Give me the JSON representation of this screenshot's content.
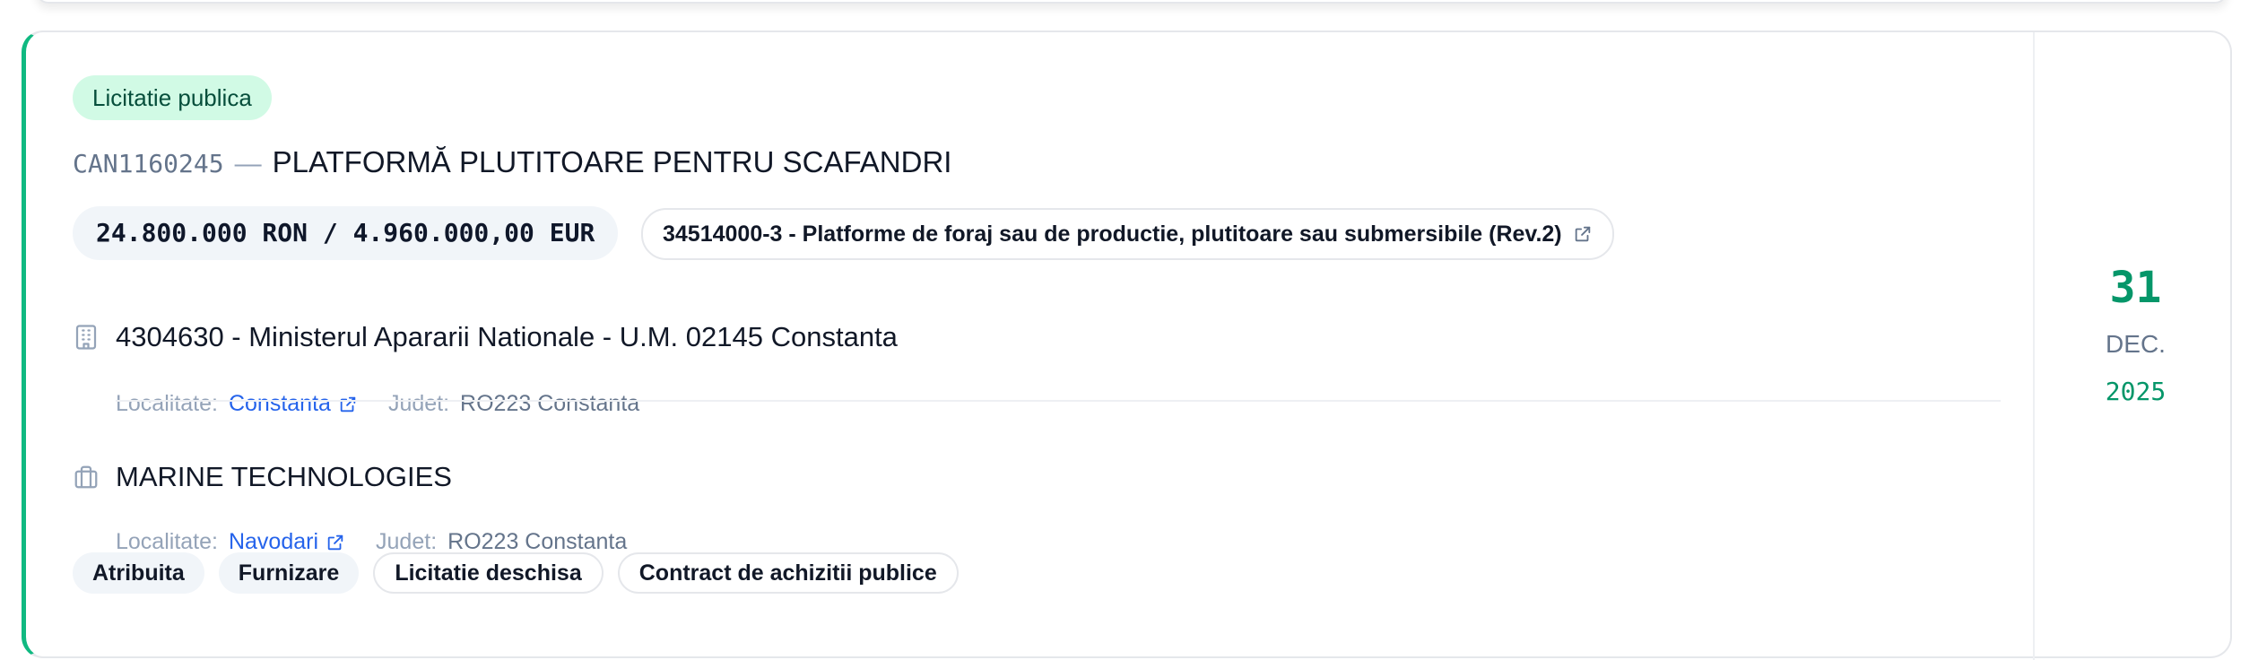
{
  "notice": {
    "type_badge": "Licitatie publica",
    "code": "CAN1160245",
    "separator": "—",
    "title": "PLATFORMĂ PLUTITOARE PENTRU SCAFANDRI",
    "value": "24.800.000 RON / 4.960.000,00 EUR",
    "cpv": "34514000-3 - Platforme de foraj sau de productie, plutitoare sau submersibile (Rev.2)"
  },
  "authority": {
    "name": "4304630 - Ministerul Apararii Nationale - U.M. 02145 Constanta",
    "locality_label": "Localitate:",
    "locality": "Constanta",
    "county_label": "Judet:",
    "county": "RO223 Constanta",
    "icon": "building-icon"
  },
  "supplier": {
    "name": "MARINE TECHNOLOGIES",
    "locality_label": "Localitate:",
    "locality": "Navodari",
    "county_label": "Judet:",
    "county": "RO223 Constanta",
    "icon": "briefcase-icon"
  },
  "tags": [
    "Atribuita",
    "Furnizare",
    "Licitatie deschisa",
    "Contract de achizitii publice"
  ],
  "date": {
    "day": "31",
    "month": "DEC.",
    "year": "2025"
  },
  "colors": {
    "accent": "#10b981",
    "accent_dark": "#059669",
    "link": "#2563eb",
    "badge_bg": "#d1fae5"
  }
}
